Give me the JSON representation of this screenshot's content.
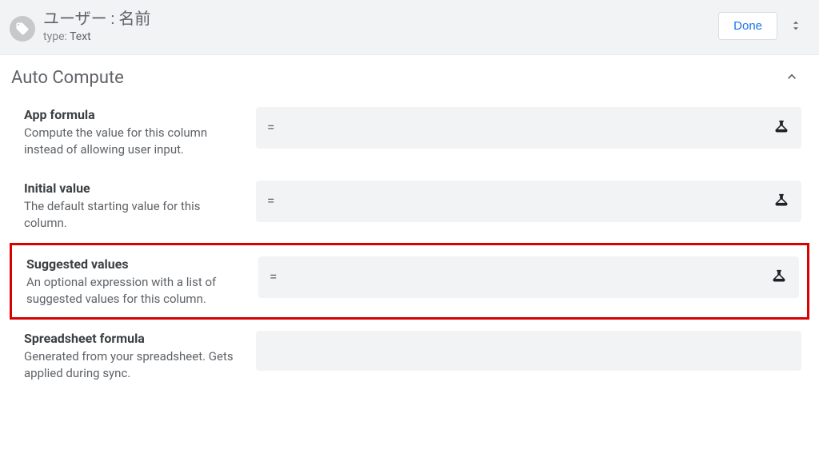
{
  "header": {
    "title": "ユーザー : 名前",
    "type_label": "type:",
    "type_value": "Text",
    "done_label": "Done"
  },
  "section": {
    "title": "Auto Compute"
  },
  "rows": {
    "app_formula": {
      "label": "App formula",
      "desc": "Compute the value for this column instead of allowing user input.",
      "sign": "="
    },
    "initial_value": {
      "label": "Initial value",
      "desc": "The default starting value for this column.",
      "sign": "="
    },
    "suggested_values": {
      "label": "Suggested values",
      "desc": "An optional expression with a list of suggested values for this column.",
      "sign": "="
    },
    "spreadsheet_formula": {
      "label": "Spreadsheet formula",
      "desc": "Generated from your spreadsheet. Gets applied during sync."
    }
  }
}
